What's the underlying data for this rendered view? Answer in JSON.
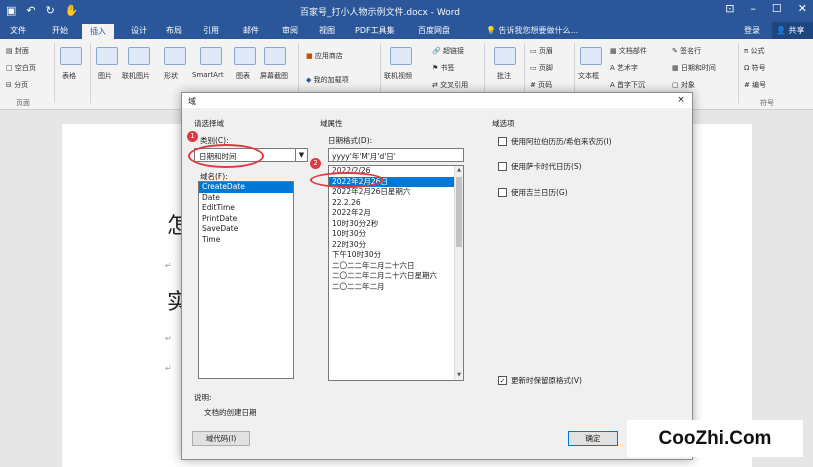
{
  "titlebar": {
    "save_icon": "save-icon",
    "undo_icon": "undo-icon",
    "redo_icon": "redo-icon",
    "touch_icon": "touch-mode-icon",
    "title": "百家号_打小人物示例文件.docx - Word",
    "window_buttons": [
      "ribbon-display-icon",
      "minimize-icon",
      "maximize-icon",
      "close-icon"
    ]
  },
  "tabs": [
    "文件",
    "开始",
    "插入",
    "设计",
    "布局",
    "引用",
    "邮件",
    "审阅",
    "视图",
    "PDF工具集",
    "百度网盘"
  ],
  "active_tab": "插入",
  "tellme": "告诉我您想要做什么...",
  "signin": "登录",
  "share": "共享",
  "ribbon": {
    "pages_items": [
      "封面",
      "空白页",
      "分页"
    ],
    "pages_group": "页面",
    "table": "表格",
    "picture": "图片",
    "online_picture": "联机图片",
    "shapes": "形状",
    "smartart": "SmartArt",
    "chart": "图表",
    "screenshot": "屏幕截图",
    "app_store": "应用商店",
    "my_addins": "我的加载项",
    "online_video": "联机视频",
    "link": "超链接",
    "bookmark": "书签",
    "cross_ref": "交叉引用",
    "comment": "批注",
    "header": "页眉",
    "footer": "页脚",
    "page_number": "页码",
    "textbox": "文本框",
    "quick_parts": "文档部件",
    "wordart": "艺术字",
    "dropcap": "首字下沉",
    "signature": "签名行",
    "datetime": "日期和时间",
    "object": "对象",
    "formula": "公式",
    "symbol": "符号",
    "number": "编号",
    "symbol_group": "符号"
  },
  "document": {
    "line1": "怎",
    "line2": "实",
    "para_mark": "↵"
  },
  "dialog": {
    "title": "域",
    "close": "×",
    "select_field_label": "请选择域",
    "category_label": "类别(C):",
    "category_value": "日期和时间",
    "field_names_label": "域名(F):",
    "field_names": [
      "CreateDate",
      "Date",
      "EditTime",
      "PrintDate",
      "SaveDate",
      "Time"
    ],
    "selected_field": "CreateDate",
    "field_props_label": "域属性",
    "date_format_label": "日期格式(D):",
    "date_format_value": "yyyy'年'M'月'd'日'",
    "date_formats": [
      "2022/2/26",
      "2022年2月26日",
      "2022年2月26日星期六",
      "22.2.26",
      "2022年2月",
      "10时30分2秒",
      "10时30分",
      "22时30分",
      "下午10时30分",
      "二〇二二年二月二十六日",
      "二〇二二年二月二十六日星期六",
      "二〇二二年二月"
    ],
    "selected_format": "2022年2月26日",
    "field_options_label": "域选项",
    "options": [
      "使用阿拉伯历历/希伯来农历(I)",
      "使用萨卡时代日历(S)",
      "使用吉兰日历(G)"
    ],
    "preserve_label": "更新时保留原格式(V)",
    "preserve_checked": "✓",
    "desc_label": "说明:",
    "desc_text": "文档的创建日期",
    "field_codes_button": "域代码(I)",
    "ok_button": "确定",
    "badge1": "1",
    "badge2": "2"
  },
  "watermark": "CooZhi.Com"
}
